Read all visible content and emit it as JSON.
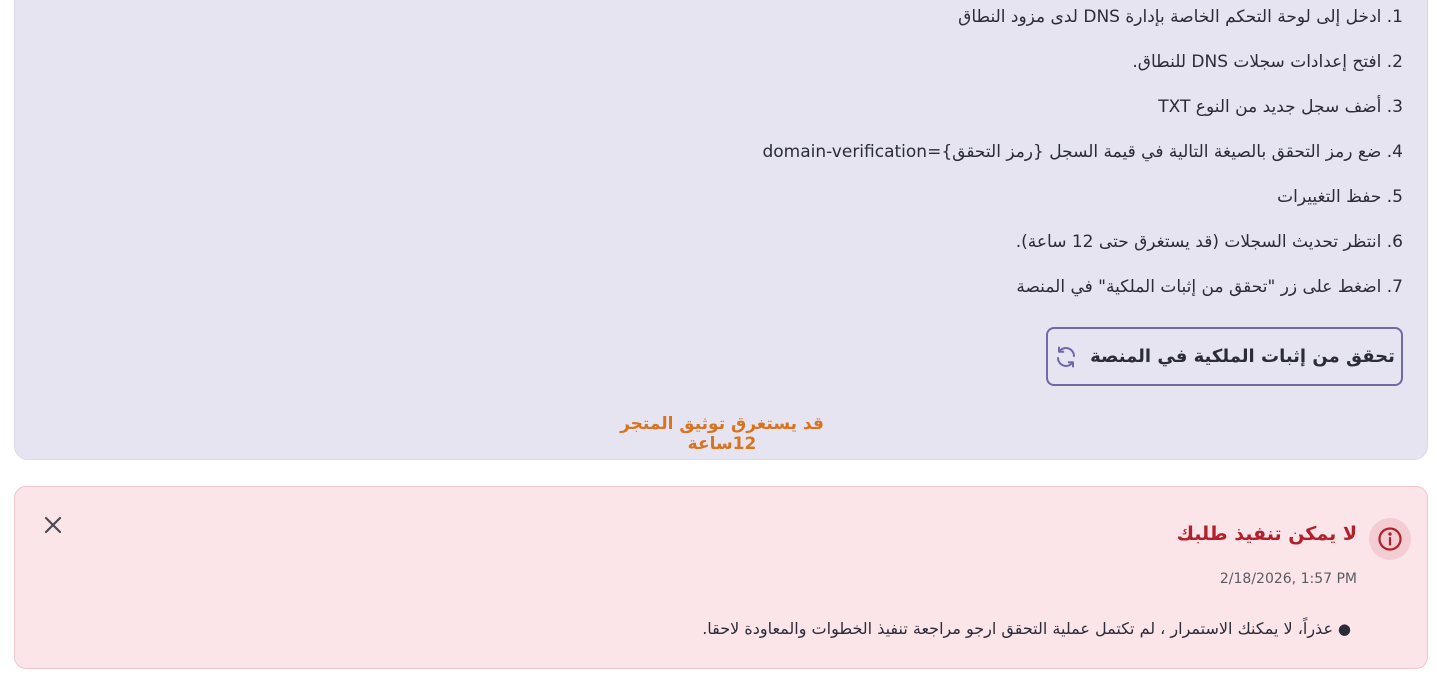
{
  "instructions": {
    "steps": [
      "1. ادخل إلى لوحة التحكم الخاصة بإدارة DNS لدى مزود النطاق",
      "2. افتح إعدادات سجلات DNS للنطاق.",
      "3. أضف سجل جديد من النوع TXT",
      "4. ضع رمز التحقق بالصيغة التالية في قيمة السجل {رمز التحقق}=domain-verification",
      "5. حفظ التغييرات",
      "6. انتظر تحديث السجلات (قد يستغرق حتى 12 ساعة).",
      "7. اضغط على زر \"تحقق من إثبات الملكية\" في المنصة"
    ],
    "verify_button_label": "تحقق من إثبات الملكية في المنصة",
    "verify_button_icon": "refresh-icon",
    "notice": "قد يستغرق توثيق المتجر 12ساعة"
  },
  "error": {
    "title": "لا يمكن تنفيذ طلبك",
    "timestamp": "2/18/2026, 1:57 PM",
    "bullet": "●",
    "message": "عذراً، لا يمكنك الاستمرار ، لم تكتمل عملية التحقق ارجو مراجعة تنفيذ الخطوات والمعاودة لاحقا.",
    "icons": {
      "info": "info-icon",
      "close": "close-icon"
    }
  },
  "colors": {
    "card_bg": "#e6e4f1",
    "button_border": "#6f69a6",
    "notice": "#d9731d",
    "error_bg": "#fbe5e8",
    "error_title": "#b3202c"
  }
}
